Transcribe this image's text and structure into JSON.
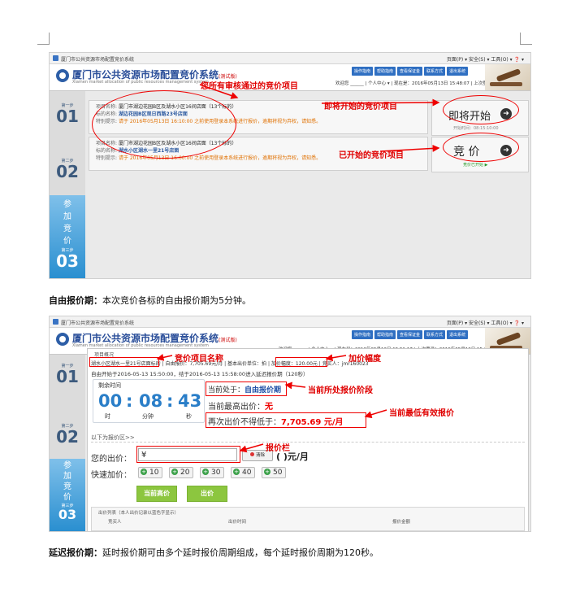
{
  "browser": {
    "tab_title": "厦门市公共资源市场配置竞价系统",
    "tools": "页面(P) ▾  安全(S) ▾  工具(O) ▾  ❓ ▾"
  },
  "app": {
    "title": "厦门市公共资源市场配置竞价系统",
    "beta": "(测试版)",
    "subtitle": "Xiamen market allocation of public resources management system",
    "nav": [
      "操作指南",
      "帮助指南",
      "查看保证金",
      "联系方式",
      "退出系统"
    ],
    "user_line_1": "欢迎您 ______ | 个人中心 ▾ | 现在是：2016年05月13日 15:48:07 | 上次登录：",
    "user_line_2": "欢迎您 ______ | 个人中心 ▾ | 现在是：2016年05月13日 15:51:17 | 上次登录：2016年05月13日 15:04:14"
  },
  "steps": [
    {
      "label": "第一步",
      "num": "01"
    },
    {
      "label": "第二步",
      "num": "02"
    },
    {
      "label": "第三步",
      "num": "03",
      "vertical": [
        "参",
        "加",
        "竞",
        "价"
      ]
    }
  ],
  "screen1": {
    "projects": [
      {
        "line1": "厦门市湖边花园B区及湖水小区16间店面（13个标的）",
        "line2": "湖边花园B区观日西路23号店面",
        "line3": "请于 2016年05月13日 16:10:00 之前使用登录本系统进行报价，逾期将视为弃权，请知悉。"
      },
      {
        "line1": "厦门市湖边花园B区及湖水小区16间店面（13个标的）",
        "line2": "湖水小区湖水一里21号店面",
        "line3": "请于 2016年05月13日 16:00:00 之前使用登录本系统进行报价，逾期将视为弃权，请知悉。"
      }
    ],
    "label_keys": [
      "项目名称:",
      "标的名称:",
      "特别提示:"
    ],
    "soon_button": "即将开始",
    "soon_time": "开始时间：08:15:10:00",
    "bid_button": "竞 价",
    "bid_sub": "竞价已开始 ▶",
    "annotations": {
      "reviewed": "您所有审核通过的竞价项目",
      "soon": "即将开始的竞价项目",
      "started": "已开始的竞价项目"
    }
  },
  "caption1": {
    "bold": "自由报价期：",
    "text": "本次竞价各标的自由报价期为5分钟。"
  },
  "screen2": {
    "panel_title": "项目概况",
    "info_line": "湖水小区湖水一里21号店面 标的 | 自由报价：7,705.69元/月 | 基本出价单位：拍 | 加价幅度：120.00元 | 竞买人：jmr160023",
    "info_parts": {
      "target": "湖水小区湖水一里21号店面标的",
      "base": " | 自由报价：7,705.69元/月 | 基本出价单位：拍 | ",
      "increment": "加价幅度：120.00元",
      "buyer": " | 竞买人：jmr160023"
    },
    "period_line": "自由开始于2016-05-13 15:50:00，结于2016-05-13 15:58:00进入延迟报价期（120秒）",
    "remaining_label": "剩余时间",
    "timer": {
      "h": "00",
      "m": "08",
      "s": "43",
      "h_unit": "时",
      "m_unit": "分钟",
      "s_unit": "秒"
    },
    "status_prefix": "当前处于：",
    "status_value": "自由报价期",
    "highest_label": "当前最高出价：",
    "highest_value": "无",
    "min_prefix": "再次出价不得低于：",
    "min_value": "7,705.69 元/月",
    "bid_area_title": "以下为报价区>>",
    "your_bid_label": "您的出价：",
    "currency": "¥",
    "clear_btn": "清除",
    "unit_text": "(  )元/月",
    "quick_label": "快速加价：",
    "quick_values": [
      "10",
      "20",
      "30",
      "40",
      "50"
    ],
    "btn_current_high": "当前高价",
    "btn_bid": "出价",
    "record_title": "出价列表（本人出价记录以蓝色字显示）",
    "record_cols": [
      "竞买人",
      "出价时间",
      "报价金额"
    ],
    "annotations": {
      "target_name": "竞价项目名称",
      "increment": "加价幅度",
      "phase": "当前所处报价阶段",
      "min_price": "当前最低有效报价",
      "bid_box": "报价栏"
    }
  },
  "caption2": {
    "bold": "延迟报价期：",
    "text": "延时报价期可由多个延时报价周期组成，每个延时报价周期为120秒。"
  }
}
